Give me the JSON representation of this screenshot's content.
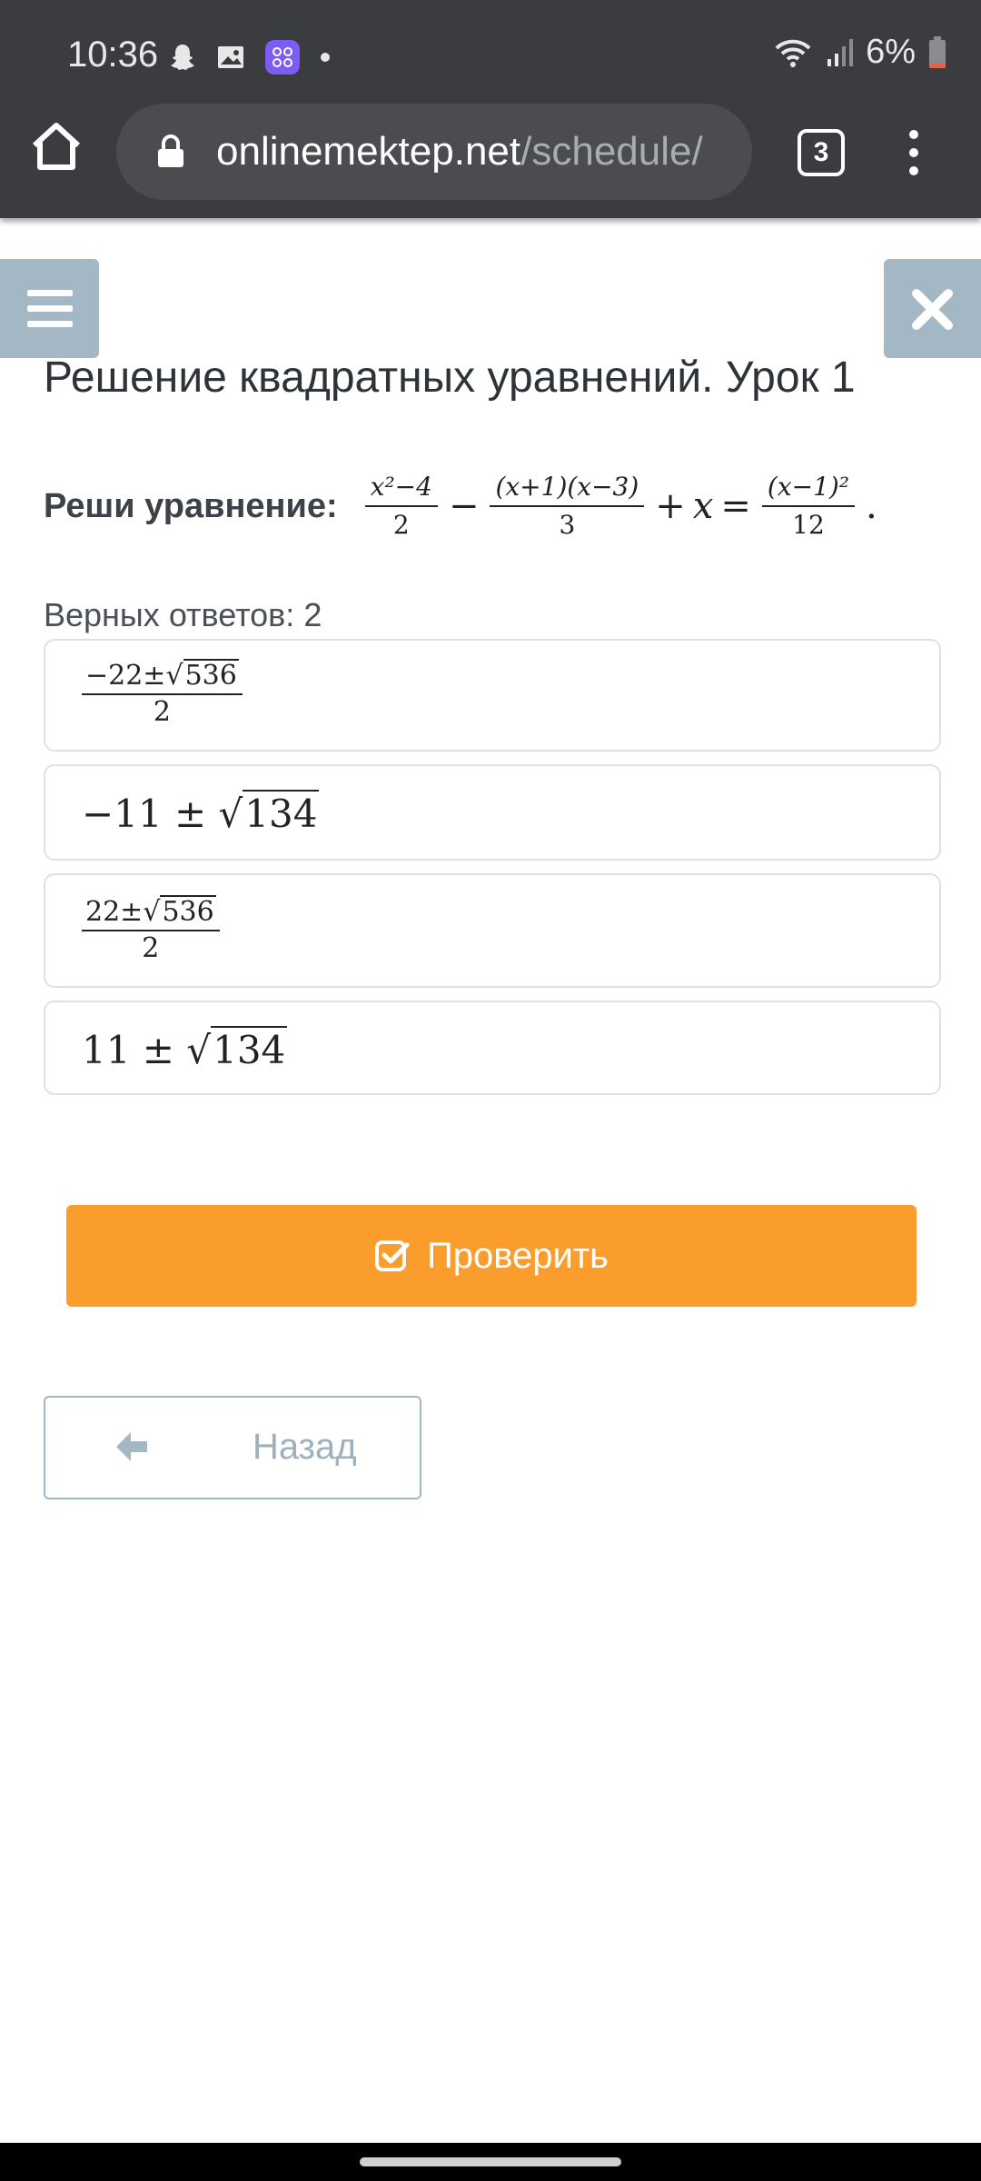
{
  "status_bar": {
    "time": "10:36",
    "battery": "6%",
    "icons_left": [
      "snapchat-icon",
      "gallery-icon",
      "app-icon",
      "dot"
    ],
    "icons_right": [
      "wifi-icon",
      "signal-icon",
      "battery-icon"
    ]
  },
  "browser": {
    "url_domain": "onlinemektep.net",
    "url_path": "/schedule/",
    "tab_count": "3"
  },
  "page": {
    "title": "Решение квадратных уравнений. Урок 1",
    "question_label": "Реши уравнение:",
    "equation": {
      "frac1_num": "x²−4",
      "frac1_den": "2",
      "op1": "−",
      "frac2_num": "(x+1)(x−3)",
      "frac2_den": "3",
      "op2": "+",
      "var": "x",
      "eq": "=",
      "frac3_num": "(x−1)²",
      "frac3_den": "12",
      "end": "."
    },
    "answers_count": "Верных ответов: 2",
    "answers": [
      {
        "num_prefix": "−22±",
        "radicand": "536",
        "den": "2"
      },
      {
        "prefix": "−11 ± ",
        "radicand": "134"
      },
      {
        "num_prefix": "22±",
        "radicand": "536",
        "den": "2"
      },
      {
        "prefix": "11 ± ",
        "radicand": "134"
      }
    ],
    "check_label": "Проверить",
    "back_label": "Назад"
  },
  "colors": {
    "accent_orange": "#fb9d2c",
    "side_button": "#a3b7c4",
    "browser_chrome": "#3a3c3f"
  }
}
